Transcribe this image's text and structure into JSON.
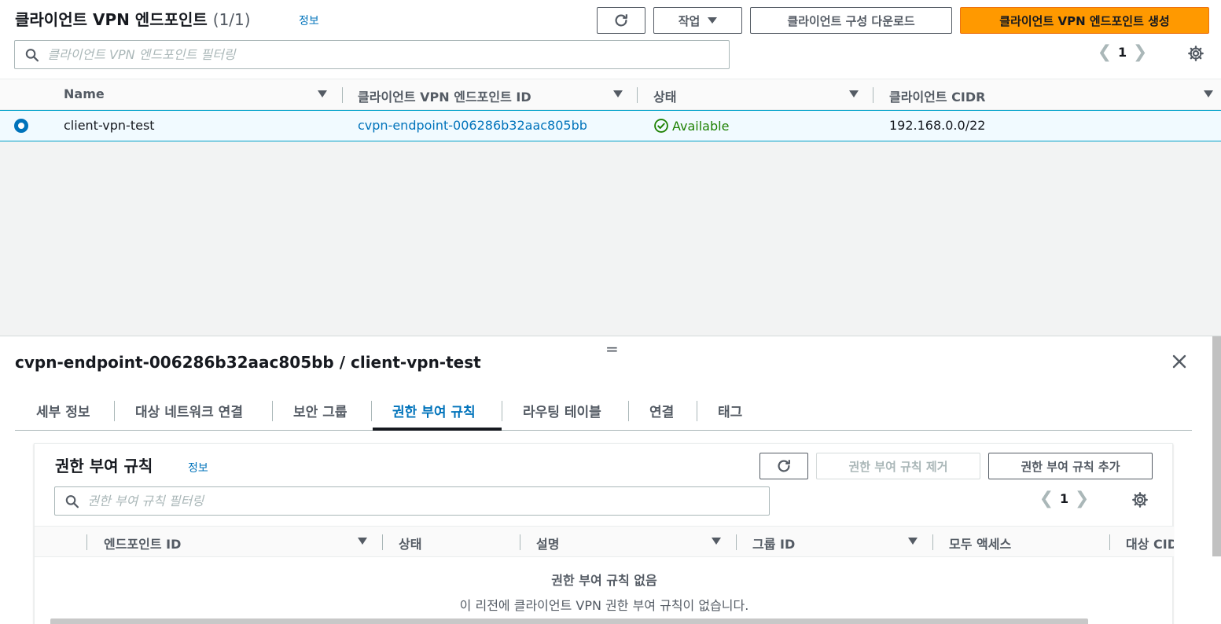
{
  "endpoints": {
    "title": "클라이언트 VPN 엔드포인트",
    "count": "(1/1)",
    "info": "정보",
    "actions_label": "작업",
    "download_label": "클라이언트 구성 다운로드",
    "create_label": "클라이언트 VPN 엔드포인트 생성",
    "search_placeholder": "클라이언트 VPN 엔드포인트 필터링",
    "page": "1",
    "columns": [
      "Name",
      "클라이언트 VPN 엔드포인트 ID",
      "상태",
      "클라이언트 CIDR"
    ],
    "rows": [
      {
        "name": "client-vpn-test",
        "id": "cvpn-endpoint-006286b32aac805bb",
        "status": "Available",
        "cidr": "192.168.0.0/22"
      }
    ]
  },
  "details": {
    "title": "cvpn-endpoint-006286b32aac805bb / client-vpn-test",
    "tabs": [
      "세부 정보",
      "대상 네트워크 연결",
      "보안 그룹",
      "권한 부여 규칙",
      "라우팅 테이블",
      "연결",
      "태그"
    ],
    "active_tab": "권한 부여 규칙"
  },
  "auth_rules": {
    "title": "권한 부여 규칙",
    "info": "정보",
    "remove_label": "권한 부여 규칙 제거",
    "add_label": "권한 부여 규칙 추가",
    "search_placeholder": "권한 부여 규칙 필터링",
    "page": "1",
    "columns": [
      "엔드포인트 ID",
      "상태",
      "설명",
      "그룹 ID",
      "모두 액세스",
      "대상 CIDR"
    ],
    "empty_title": "권한 부여 규칙 없음",
    "empty_message": "이 리전에 클라이언트 VPN 권한 부여 규칙이 없습니다."
  },
  "colors": {
    "primary": "#ff9900",
    "link": "#0073bb",
    "success": "#1d8102",
    "selected_row": "#f1faff"
  }
}
